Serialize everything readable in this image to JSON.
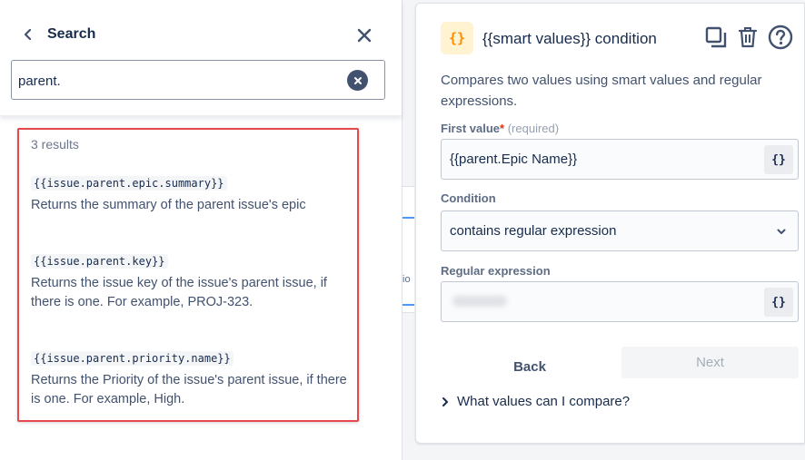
{
  "search": {
    "title": "Search",
    "query": "parent.",
    "results_count": "3 results",
    "results": [
      {
        "code": "{{issue.parent.epic.summary}}",
        "description": "Returns the summary of the parent issue's epic"
      },
      {
        "code": "{{issue.parent.key}}",
        "description": "Returns the issue key of the issue's parent issue, if there is one. For example, PROJ-323."
      },
      {
        "code": "{{issue.parent.priority.name}}",
        "description": "Returns the Priority of the issue's parent issue, if there is one. For example, High."
      }
    ],
    "highlight_color": "#e5484d"
  },
  "underlay": {
    "text": "io"
  },
  "condition": {
    "icon_text": "{}",
    "title": "{{smart values}} condition",
    "description": "Compares two values using smart values and regular expressions.",
    "first_value": {
      "label": "First value",
      "required_mark": "*",
      "required_hint": "(required)",
      "value": "{{parent.Epic Name}}",
      "button_text": "{}"
    },
    "condition_field": {
      "label": "Condition",
      "value": "contains regular expression"
    },
    "regex": {
      "label": "Regular expression",
      "button_text": "{}"
    },
    "back_label": "Back",
    "next_label": "Next",
    "expander_label": "What values can I compare?"
  },
  "colors": {
    "accent_orange": "#ff8b00",
    "icon_bg": "#fff3d1",
    "text_primary": "#172b4d"
  }
}
